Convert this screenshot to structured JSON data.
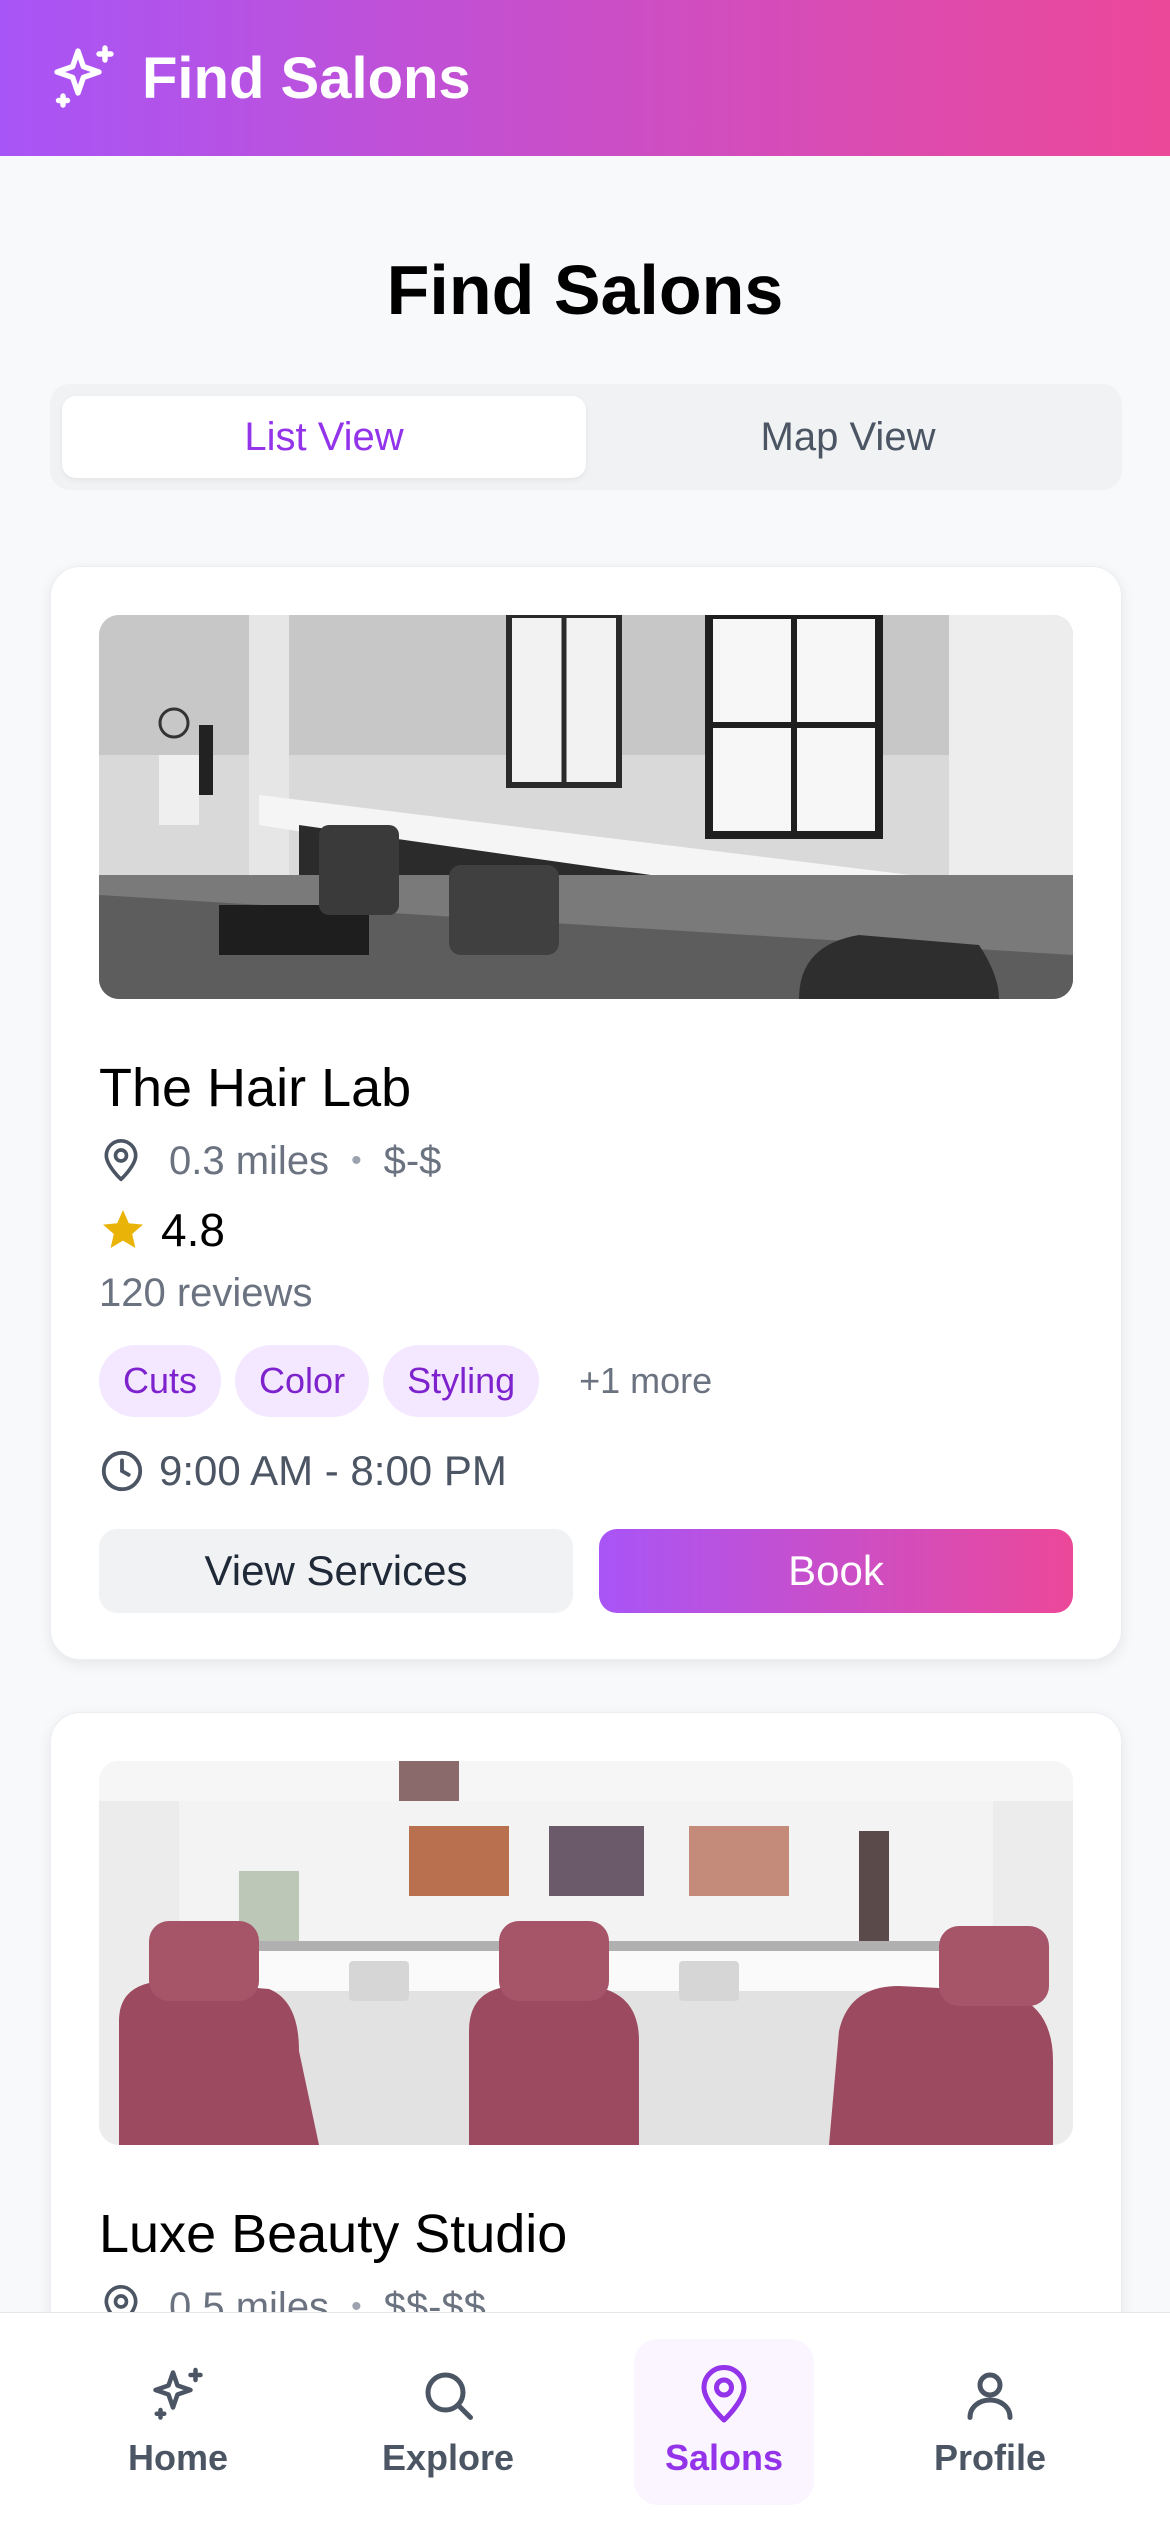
{
  "header": {
    "title": "Find Salons"
  },
  "page": {
    "title": "Find Salons"
  },
  "view_toggle": {
    "list": "List View",
    "map": "Map View",
    "active": "list"
  },
  "salons": [
    {
      "name": "The Hair Lab",
      "distance": "0.3 miles",
      "price": "$-$",
      "rating": "4.8",
      "reviews": "120 reviews",
      "tags": [
        "Cuts",
        "Color",
        "Styling"
      ],
      "more": "+1 more",
      "hours": "9:00 AM - 8:00 PM",
      "view_services": "View Services",
      "book": "Book"
    },
    {
      "name": "Luxe Beauty Studio",
      "distance": "0.5 miles",
      "price": "$$-$$"
    }
  ],
  "nav": [
    {
      "label": "Home",
      "icon": "sparkles-icon"
    },
    {
      "label": "Explore",
      "icon": "search-icon"
    },
    {
      "label": "Salons",
      "icon": "map-pin-icon",
      "active": true
    },
    {
      "label": "Profile",
      "icon": "user-icon"
    }
  ],
  "colors": {
    "gradient_start": "#a855f7",
    "gradient_end": "#ec4899",
    "accent": "#9333ea",
    "tag_bg": "#f3e8ff",
    "star": "#eab308"
  }
}
